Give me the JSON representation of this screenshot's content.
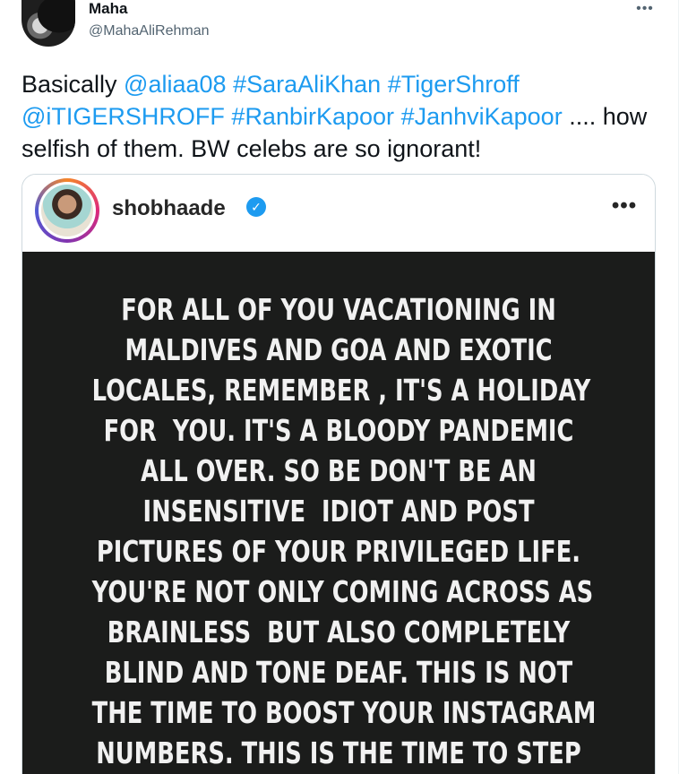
{
  "author": {
    "name": "Maha",
    "handle": "@MahaAliRehman"
  },
  "more_icon": "more-horizontal-icon",
  "tweet": {
    "lines": [
      [
        {
          "text": "Basically ",
          "link": false
        },
        {
          "text": "@aliaa08",
          "link": true
        },
        {
          "text": " ",
          "link": false
        },
        {
          "text": "#SaraAliKhan",
          "link": true
        },
        {
          "text": " ",
          "link": false
        },
        {
          "text": "#TigerShroff",
          "link": true
        }
      ],
      [
        {
          "text": "@iTIGERSHROFF",
          "link": true
        },
        {
          "text": " ",
          "link": false
        },
        {
          "text": "#RanbirKapoor",
          "link": true
        },
        {
          "text": " ",
          "link": false
        },
        {
          "text": "#JanhviKapoor",
          "link": true
        },
        {
          "text": " .... how",
          "link": false
        }
      ],
      [
        {
          "text": "selfish of them. BW celebs are so ignorant!",
          "link": false
        }
      ]
    ],
    "link_color": "#1d9bf0"
  },
  "embed": {
    "ig_username": "shobhaade",
    "verified_icon": "verified-badge-icon",
    "more_icon": "more-horizontal-icon",
    "story_lines": [
      "FOR ALL OF YOU VACATIONING IN",
      "MALDIVES AND GOA AND EXOTIC",
      "LOCALES, REMEMBER , IT'S A HOLIDAY",
      "FOR  YOU. IT'S A BLOODY PANDEMIC",
      "ALL OVER. SO BE DON'T BE AN",
      "INSENSITIVE  IDIOT AND POST",
      "PICTURES OF YOUR PRIVILEGED LIFE.",
      "YOU'RE NOT ONLY COMING ACROSS AS",
      "BRAINLESS  BUT ALSO COMPLETELY",
      "BLIND AND TONE DEAF. THIS IS NOT",
      "THE TIME TO BOOST YOUR INSTAGRAM",
      "NUMBERS. THIS IS THE TIME TO STEP"
    ]
  }
}
